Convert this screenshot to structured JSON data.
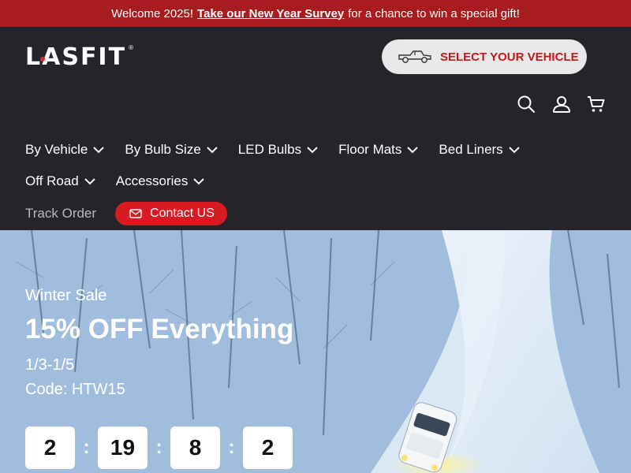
{
  "announcement": {
    "prefix": "Welcome 2025!",
    "link": "Take our New Year Survey",
    "suffix": "for a chance to win a special gift!"
  },
  "header": {
    "logo": "LASFIT",
    "logo_mark": "®",
    "vehicle_button": "SELECT YOUR VEHICLE",
    "icons": [
      "search-icon",
      "account-icon",
      "cart-icon"
    ]
  },
  "nav": {
    "row1": [
      "By Vehicle",
      "By Bulb Size",
      "LED Bulbs",
      "Floor Mats",
      "Bed Liners"
    ],
    "row2": [
      "Off Road",
      "Accessories"
    ],
    "track_order": "Track Order",
    "contact": "Contact US"
  },
  "hero": {
    "eyebrow": "Winter Sale",
    "headline": "15% OFF Everything",
    "dates": "1/3-1/5",
    "code": "Code: HTW15",
    "countdown": [
      "2",
      "19",
      "8",
      "2"
    ],
    "separator": ":"
  },
  "colors": {
    "announcement_bg": "#a81c1f",
    "header_bg": "#23252a",
    "accent": "#d81b22",
    "vehicle_text": "#c8161d"
  }
}
